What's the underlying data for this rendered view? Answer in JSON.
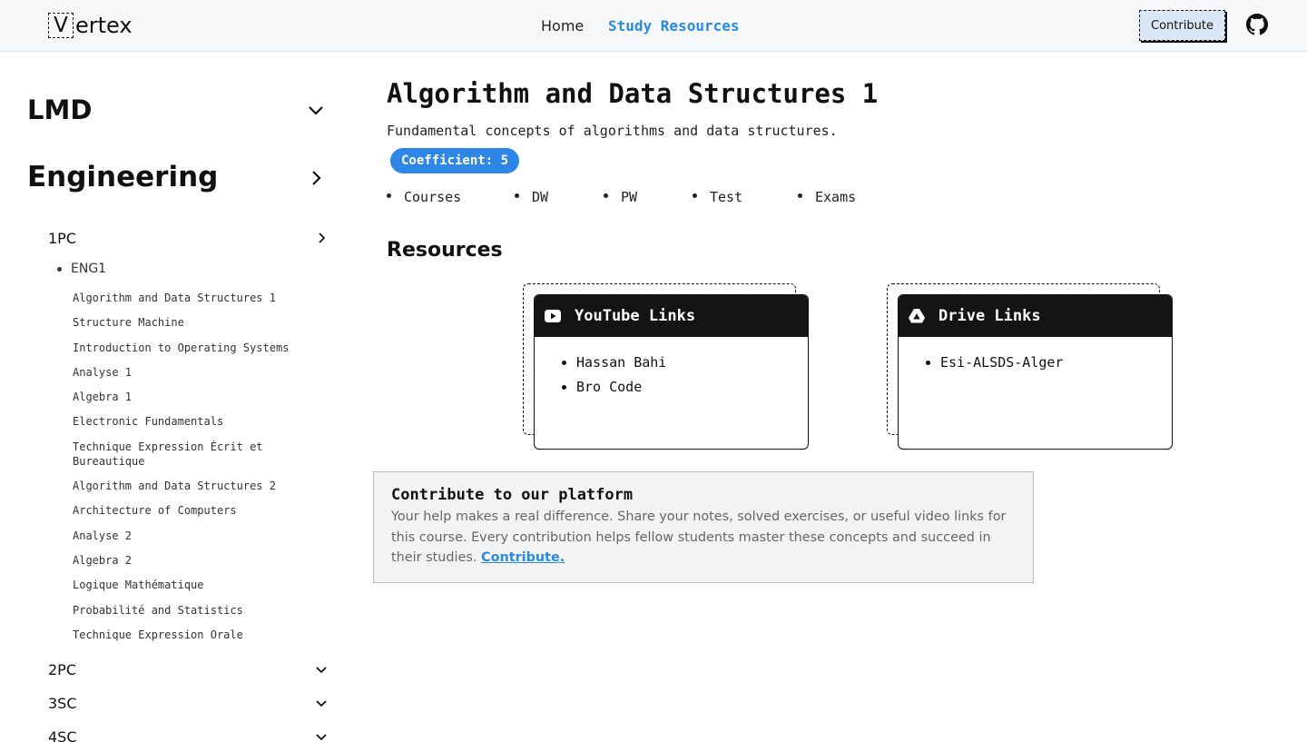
{
  "header": {
    "logo_letter": "V",
    "logo_rest": "ertex",
    "nav": {
      "home": "Home",
      "study": "Study Resources"
    },
    "contribute_label": "Contribute",
    "github_icon": "github-icon"
  },
  "sidebar": {
    "lmd": "LMD",
    "engineering": "Engineering",
    "years": {
      "y1": "1PC",
      "y2": "2PC",
      "y3": "3SC",
      "y4": "4SC"
    },
    "semester": "ENG1",
    "modules": [
      "Algorithm and Data Structures 1",
      "Structure Machine",
      "Introduction to Operating Systems",
      "Analyse 1",
      "Algebra 1",
      "Electronic Fundamentals",
      "Technique Expression Écrit et Bureautique",
      "Algorithm and Data Structures 2",
      "Architecture of Computers",
      "Analyse 2",
      "Algebra 2",
      "Logique Mathématique",
      "Probabilité and Statistics",
      "Technique Expression Orale"
    ]
  },
  "course": {
    "title": "Algorithm and Data Structures 1",
    "description": "Fundamental concepts of algorithms and data structures.",
    "coefficient": "Coefficient: 5",
    "types": [
      "Courses",
      "DW",
      "PW",
      "Test",
      "Exams"
    ]
  },
  "resources": {
    "title": "Resources",
    "youtube": {
      "title": "YouTube Links",
      "links": [
        "Hassan Bahi",
        "Bro Code"
      ]
    },
    "drive": {
      "title": "Drive Links",
      "links": [
        "Esi-ALSDS-Alger"
      ]
    }
  },
  "contribute_box": {
    "title": "Contribute to our platform",
    "text": "Your help makes a real difference. Share your notes, solved exercises, or useful video links for this course. Every contribution helps fellow students master these concepts and succeed in their studies.",
    "link": "Contribute."
  },
  "colors": {
    "accent": "#2a8ae0",
    "badge": "#2d86e8",
    "card_header": "#141414"
  }
}
